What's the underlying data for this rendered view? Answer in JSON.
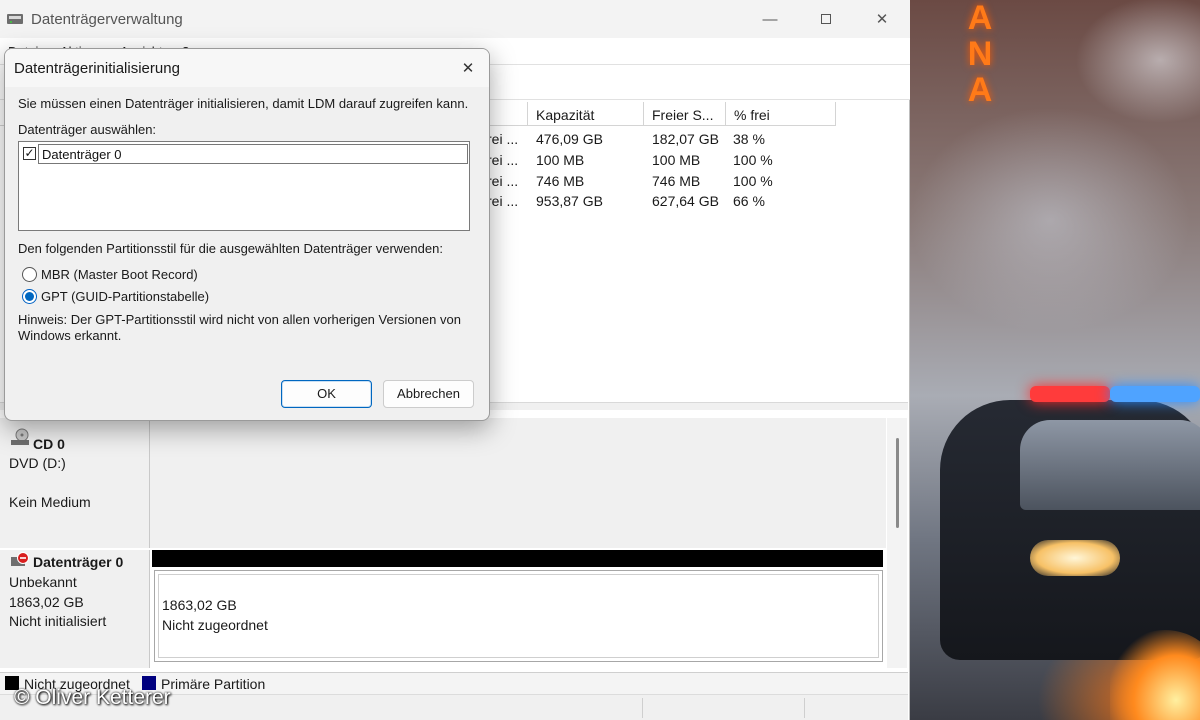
{
  "main_window": {
    "title": "Datenträgerverwaltung",
    "menu": [
      "Datei",
      "Aktion",
      "Ansicht",
      "?"
    ],
    "columns": [
      "Kapazität",
      "Freier S...",
      "% frei"
    ],
    "volumes": [
      {
        "status_trunc": "rei ...",
        "capacity": "476,09 GB",
        "free": "182,07 GB",
        "percent_free": "38 %"
      },
      {
        "status_trunc": "rei ...",
        "capacity": "100 MB",
        "free": "100 MB",
        "percent_free": "100 %"
      },
      {
        "status_trunc": "rei ...",
        "capacity": "746 MB",
        "free": "746 MB",
        "percent_free": "100 %"
      },
      {
        "status_trunc": "rei ...",
        "capacity": "953,87 GB",
        "free": "627,64 GB",
        "percent_free": "66 %"
      }
    ],
    "cd": {
      "name": "CD 0",
      "drive": "DVD (D:)",
      "media": "Kein Medium"
    },
    "disk0": {
      "name": "Datenträger 0",
      "type": "Unbekannt",
      "size": "1863,02 GB",
      "state": "Nicht initialisiert",
      "partition": {
        "size": "1863,02 GB",
        "label": "Nicht zugeordnet"
      }
    },
    "legend": {
      "unallocated": "Nicht zugeordnet",
      "primary": "Primäre Partition"
    }
  },
  "dialog": {
    "title": "Datenträgerinitialisierung",
    "intro": "Sie müssen einen Datenträger initialisieren, damit LDM darauf zugreifen kann.",
    "select_label": "Datenträger auswählen:",
    "disks": [
      {
        "label": "Datenträger 0",
        "checked": true
      }
    ],
    "style_label": "Den folgenden Partitionsstil für die ausgewählten Datenträger verwenden:",
    "options": [
      {
        "label": "MBR (Master Boot Record)",
        "selected": false
      },
      {
        "label": "GPT (GUID-Partitionstabelle)",
        "selected": true
      }
    ],
    "note_line1": "Hinweis: Der GPT-Partitionsstil wird nicht von allen vorherigen Versionen von",
    "note_line2": "Windows erkannt.",
    "ok_label": "OK",
    "cancel_label": "Abbrechen"
  },
  "watermark": "© Oliver Ketterer",
  "desktop": {
    "neon_sign": [
      "A",
      "N",
      "A"
    ]
  },
  "colors": {
    "accent": "#0067c0",
    "primary_partition": "#00007f",
    "unallocated": "#000000"
  }
}
